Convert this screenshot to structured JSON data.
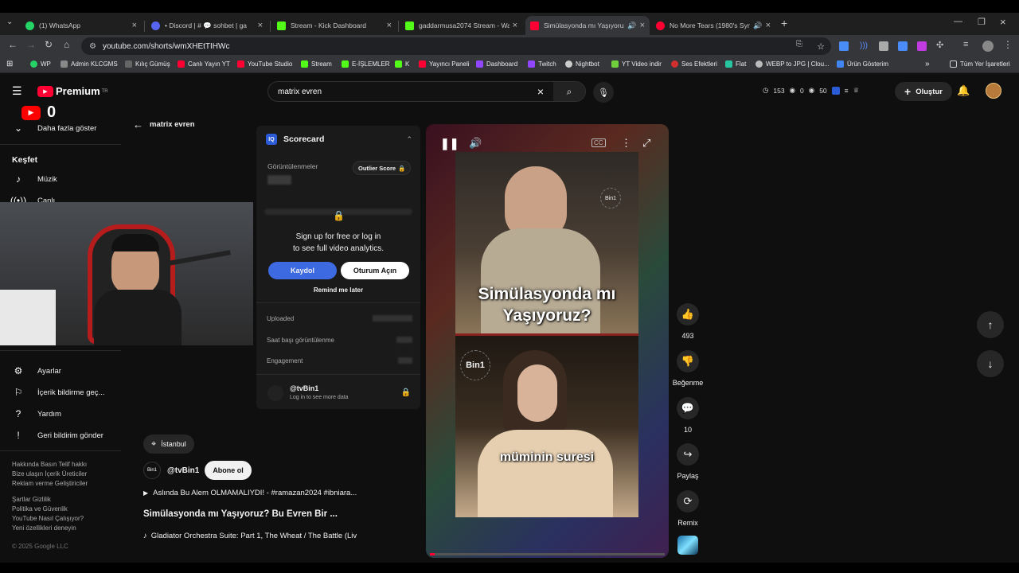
{
  "browser": {
    "tabs": [
      {
        "title": "(1) WhatsApp",
        "color": "#25d366"
      },
      {
        "title": "• Discord | # 💬 sohbet | ga",
        "color": "#5865f2"
      },
      {
        "title": "Stream - Kick Dashboard",
        "color": "#53fc18"
      },
      {
        "title": "gaddarmusa2074 Stream - Wat",
        "color": "#53fc18"
      },
      {
        "title": "Simülasyonda mı Yaşıyoruz",
        "color": "#ff0033"
      },
      {
        "title": "No More Tears (1980's Synt",
        "color": "#ff0033"
      }
    ],
    "url": "youtube.com/shorts/wmXHEtTIHWc",
    "bookmarks": [
      {
        "label": "WP",
        "color": "#25d366"
      },
      {
        "label": "Admin KLCGMS",
        "color": "#888888"
      },
      {
        "label": "Kılıç Gümüş",
        "color": "#666666"
      },
      {
        "label": "Canlı Yayın YT",
        "color": "#ff0033"
      },
      {
        "label": "YouTube Studio",
        "color": "#ff0033"
      },
      {
        "label": "Stream",
        "color": "#53fc18"
      },
      {
        "label": "E-İŞLEMLER",
        "color": "#53fc18"
      },
      {
        "label": "K",
        "color": "#53fc18"
      },
      {
        "label": "Yayıncı Paneli",
        "color": "#ff0033"
      },
      {
        "label": "Dashboard",
        "color": "#9146ff"
      },
      {
        "label": "Twitch",
        "color": "#9146ff"
      },
      {
        "label": "Nightbot",
        "color": "#cccccc"
      },
      {
        "label": "YT Video indir",
        "color": "#6fcf3c"
      },
      {
        "label": "Ses Efektleri",
        "color": "#d32f2f"
      },
      {
        "label": "Flat",
        "color": "#26c6a0"
      },
      {
        "label": "WEBP to JPG | Clou...",
        "color": "#bbbbbb"
      },
      {
        "label": "Ürün Gösterim",
        "color": "#4285f4"
      }
    ],
    "all_bookmarks": "Tüm Yer İşaretleri"
  },
  "header": {
    "logo_text": "Premium",
    "logo_sup": "TR",
    "search_value": "matrix evren",
    "stats": {
      "a": "153",
      "b": "0",
      "c": "50"
    },
    "create_label": "Oluştur"
  },
  "sidebar": {
    "show_more": "Daha fazla göster",
    "explore_title": "Keşfet",
    "explore_items": [
      "Müzik",
      "Canlı"
    ],
    "settings_items": [
      "Ayarlar",
      "İçerik bildirme geç...",
      "Yardım",
      "Geri bildirim gönder"
    ],
    "footer_links_1": "Hakkında  Basın  Telif hakkı",
    "footer_links_2": "Bize ulaşın  İçerik Üreticiler",
    "footer_links_3": "Reklam verme  Geliştiriciler",
    "footer_links_4": "Şartlar  Gizlilik",
    "footer_links_5": "Politika ve Güvenlik",
    "footer_links_6": "YouTube Nasıl Çalışıyor?",
    "footer_links_7": "Yeni özellikleri deneyin",
    "copyright": "© 2025 Google LLC"
  },
  "overlay": {
    "yt_count": "0"
  },
  "back_query": "matrix evren",
  "scorecard": {
    "title": "Scorecard",
    "views_label": "Görüntülenmeler",
    "outlier_label": "Outlier Score",
    "signup_1": "Sign up for free or log in",
    "signup_2": "to see full video analytics.",
    "signup_btn": "Kaydol",
    "login_btn": "Oturum Açın",
    "remind": "Remind me later",
    "uploaded": "Uploaded",
    "hourly": "Saat başı görüntülenme",
    "engagement": "Engagement",
    "channel_handle": "@tvBin1",
    "channel_sub": "Log in to see more data"
  },
  "video": {
    "location": "İstanbul",
    "channel": "@tvBin1",
    "channel_avatar": "Bin1",
    "subscribe": "Abone ol",
    "desc_line": "Aslında Bu Alem OLMAMALIYDI! - #ramazan2024 #ibniara...",
    "title": "Simülasyonda mı Yaşıyoruz? Bu Evren Bir ...",
    "music": "Gladiator Orchestra Suite: Part 1, The Wheat / The Battle (Liv",
    "caption_top_1": "Simülasyonda mı",
    "caption_top_2": "Yaşıyoruz?",
    "caption_bottom": "müminin suresi",
    "watermark": "Bin1",
    "progress": 0.02
  },
  "actions": {
    "like_count": "493",
    "dislike_label": "Beğenme",
    "comment_count": "10",
    "share_label": "Paylaş",
    "remix_label": "Remix"
  }
}
